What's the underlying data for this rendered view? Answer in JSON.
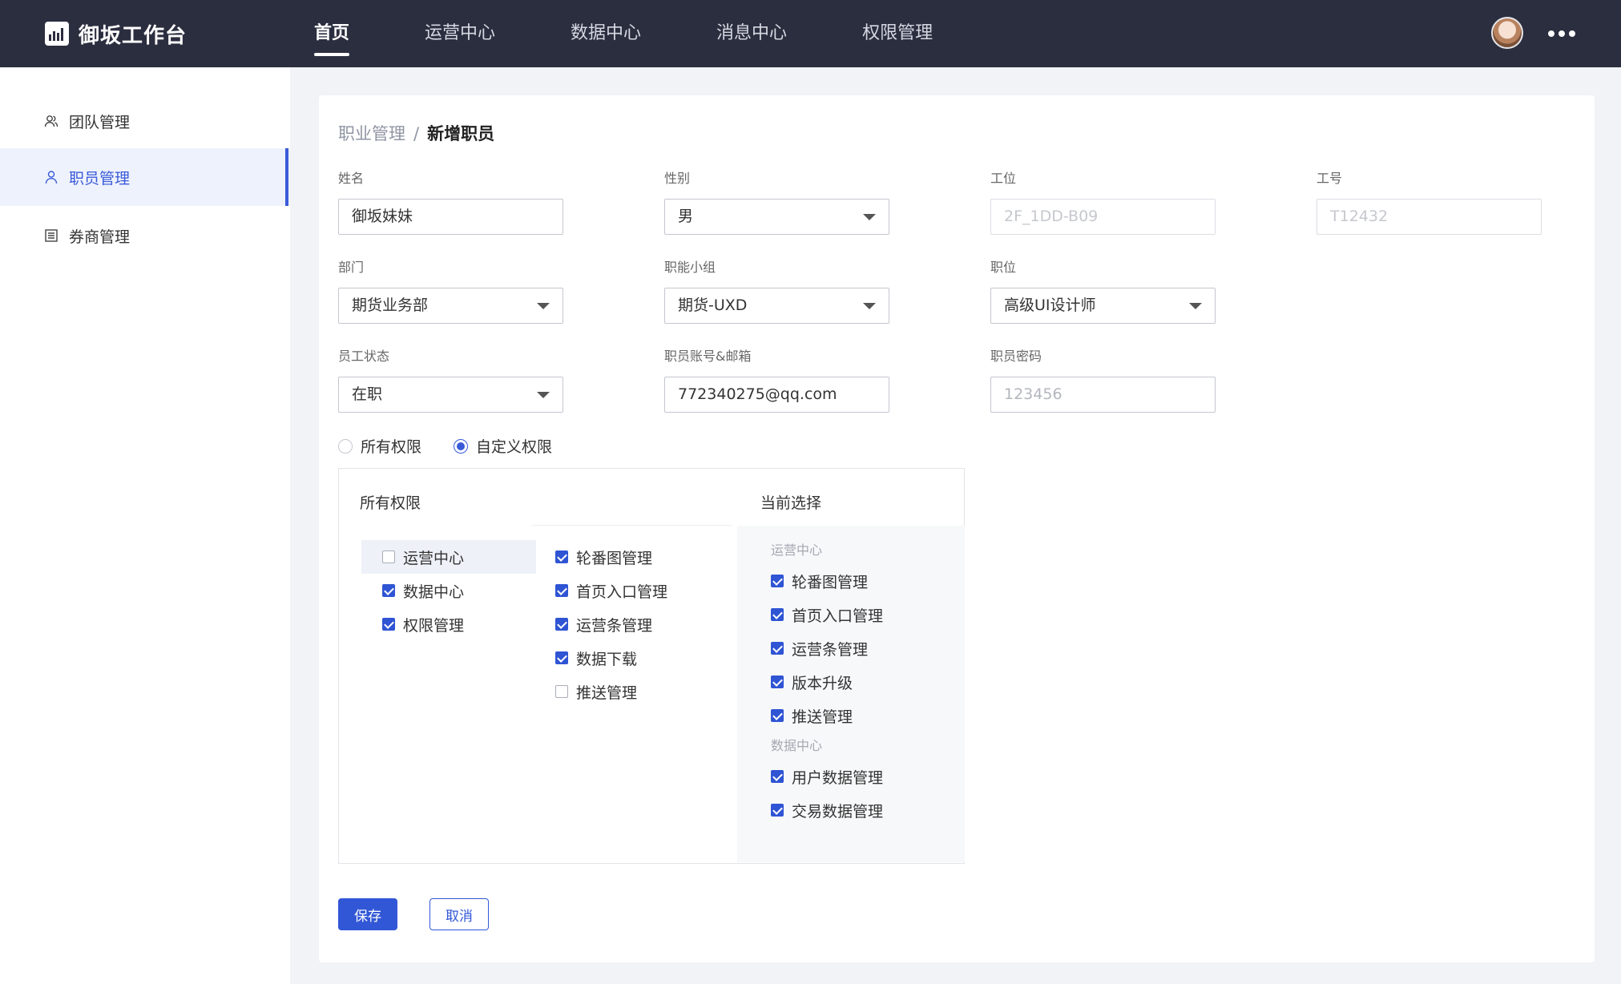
{
  "app": {
    "title": "御坂工作台"
  },
  "nav": {
    "items": [
      {
        "label": "首页",
        "active": true
      },
      {
        "label": "运营中心"
      },
      {
        "label": "数据中心"
      },
      {
        "label": "消息中心"
      },
      {
        "label": "权限管理"
      }
    ]
  },
  "sidebar": {
    "items": [
      {
        "label": "团队管理",
        "icon": "team-icon"
      },
      {
        "label": "职员管理",
        "icon": "user-icon",
        "active": true
      },
      {
        "label": "券商管理",
        "icon": "list-icon"
      }
    ]
  },
  "breadcrumb": {
    "parent": "职业管理",
    "separator": "/",
    "current": "新增职员"
  },
  "form": {
    "name": {
      "label": "姓名",
      "value": "御坂妹妹"
    },
    "gender": {
      "label": "性别",
      "value": "男"
    },
    "seat": {
      "label": "工位",
      "value": "2F_1DD-B09"
    },
    "employee_id": {
      "label": "工号",
      "value": "T12432"
    },
    "department": {
      "label": "部门",
      "value": "期货业务部"
    },
    "group": {
      "label": "职能小组",
      "value": "期货-UXD"
    },
    "position": {
      "label": "职位",
      "value": "高级UI设计师"
    },
    "status": {
      "label": "员工状态",
      "value": "在职"
    },
    "account": {
      "label": "职员账号&邮箱",
      "value": "772340275@qq.com"
    },
    "password": {
      "label": "职员密码",
      "placeholder": "123456"
    }
  },
  "permission_mode": {
    "options": [
      {
        "label": "所有权限",
        "checked": false
      },
      {
        "label": "自定义权限",
        "checked": true
      }
    ]
  },
  "permissions": {
    "all_title": "所有权限",
    "current_title": "当前选择",
    "modules": [
      {
        "label": "运营中心",
        "checked": false
      },
      {
        "label": "数据中心",
        "checked": true
      },
      {
        "label": "权限管理",
        "checked": true
      }
    ],
    "sub_items": [
      {
        "label": "轮番图管理",
        "checked": true
      },
      {
        "label": "首页入口管理",
        "checked": true
      },
      {
        "label": "运营条管理",
        "checked": true
      },
      {
        "label": "数据下载",
        "checked": true
      },
      {
        "label": "推送管理",
        "checked": false
      }
    ],
    "selected_groups": [
      {
        "group": "运营中心",
        "items": [
          "轮番图管理",
          "首页入口管理",
          "运营条管理",
          "版本升级",
          "推送管理"
        ]
      },
      {
        "group": "数据中心",
        "items": [
          "用户数据管理",
          "交易数据管理"
        ]
      }
    ]
  },
  "actions": {
    "save": "保存",
    "cancel": "取消"
  },
  "colors": {
    "accent": "#3257d6",
    "topbar": "#2b2e3f"
  }
}
